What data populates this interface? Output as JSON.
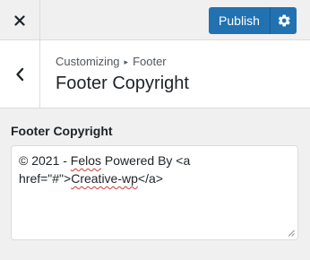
{
  "topbar": {
    "close_icon": "close-icon",
    "publish_label": "Publish",
    "settings_icon": "gear-icon"
  },
  "header": {
    "back_icon": "chevron-left-icon",
    "breadcrumb": {
      "parent": "Customizing",
      "separator": "▸",
      "current": "Footer"
    },
    "title": "Footer Copyright"
  },
  "control": {
    "label": "Footer Copyright",
    "value_parts": [
      "© 2021 -  ",
      "Felos",
      "  Powered By <a href=\"#\">",
      "Creative-wp",
      "</a>"
    ]
  },
  "colors": {
    "accent": "#2271b1",
    "background": "#f0f0f1",
    "spellcheck": "#d63638"
  }
}
